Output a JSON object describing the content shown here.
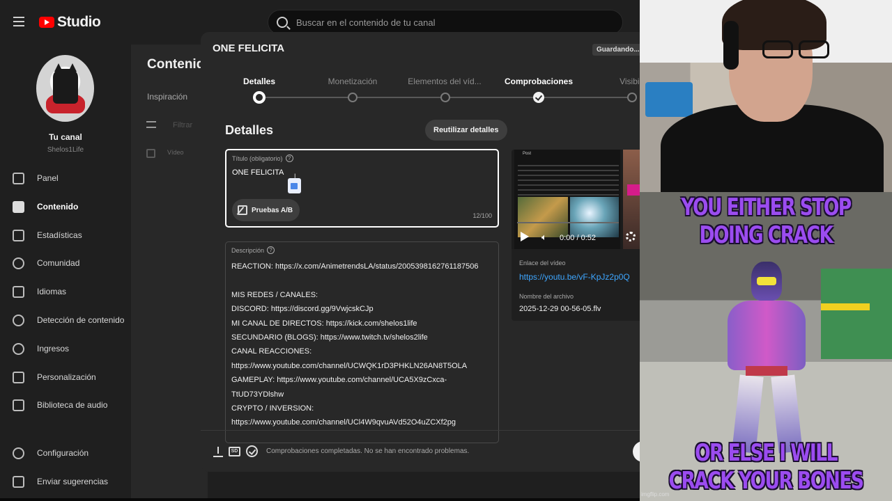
{
  "studio": {
    "logo_text": "Studio",
    "search_placeholder": "Buscar en el contenido de tu canal",
    "channel": {
      "label": "Tu canal",
      "handle": "Shelos1Life"
    },
    "nav": [
      {
        "label": "Panel",
        "icon": "dashboard-icon"
      },
      {
        "label": "Contenido",
        "icon": "content-icon",
        "active": true
      },
      {
        "label": "Estadísticas",
        "icon": "analytics-icon"
      },
      {
        "label": "Comunidad",
        "icon": "community-icon"
      },
      {
        "label": "Idiomas",
        "icon": "subtitles-icon"
      },
      {
        "label": "Detección de contenido",
        "icon": "copyright-icon"
      },
      {
        "label": "Ingresos",
        "icon": "earn-icon"
      },
      {
        "label": "Personalización",
        "icon": "customization-icon"
      },
      {
        "label": "Biblioteca de audio",
        "icon": "audio-library-icon"
      }
    ],
    "nav_bottom": [
      {
        "label": "Configuración",
        "icon": "settings-icon"
      },
      {
        "label": "Enviar sugerencias",
        "icon": "feedback-icon"
      }
    ],
    "content_page": {
      "title": "Contenido",
      "tab": "Inspiración",
      "filter_placeholder": "Filtrar",
      "video_col": "Vídeo"
    }
  },
  "dialog": {
    "title": "ONE FELICITA",
    "status_badge": "Guardando...",
    "steps": [
      {
        "label": "Detalles",
        "state": "current"
      },
      {
        "label": "Monetización",
        "state": "pending"
      },
      {
        "label": "Elementos del víd...",
        "state": "pending"
      },
      {
        "label": "Comprobaciones",
        "state": "done"
      },
      {
        "label": "Visibili",
        "state": "pending"
      }
    ],
    "section_title": "Detalles",
    "reuse_button": "Reutilizar detalles",
    "title_field": {
      "label": "Título (obligatorio)",
      "value": "ONE FELICITA",
      "ab_button": "Pruebas A/B",
      "counter": "12/100"
    },
    "description_field": {
      "label": "Descripción",
      "lines": [
        "REACTION: https://x.com/AnimetrendsLA/status/2005398162761187506",
        "",
        "MIS REDES / CANALES:",
        "DISCORD: https://discord.gg/9VwjcskCJp",
        "MI CANAL DE DIRECTOS: https://kick.com/shelos1life",
        "SECUNDARIO (BLOGS): https://www.twitch.tv/shelos2life",
        "CANAL REACCIONES:",
        "https://www.youtube.com/channel/UCWQK1rD3PHKLN26AN8T5OLA",
        "GAMEPLAY: https://www.youtube.com/channel/UCA5X9zCxca-",
        "TtUD73YDlshw",
        "CRYPTO / INVERSION:",
        "https://www.youtube.com/channel/UCl4W9qvuAVd52O4uZCXf2pg"
      ]
    },
    "preview": {
      "tweet_header": "Post",
      "time": "0:00 / 0:52",
      "link_label": "Enlace del vídeo",
      "link": "https://youtu.be/vF-KpJz2p0Q",
      "file_label": "Nombre del archivo",
      "file_name": "2025-12-29 00-56-05.flv"
    },
    "footer_status": "Comprobaciones completadas. No se han encontrado problemas.",
    "sd_badge": "SD"
  },
  "meme": {
    "top_text": "YOU EITHER STOP DOING CRACK",
    "bottom_text": "OR ELSE I WILL CRACK YOUR BONES",
    "watermark": "imgflip.com"
  },
  "colors": {
    "link": "#3ea6ff",
    "meme_text": "#9b4cf0",
    "brand_red": "#ff0000"
  }
}
